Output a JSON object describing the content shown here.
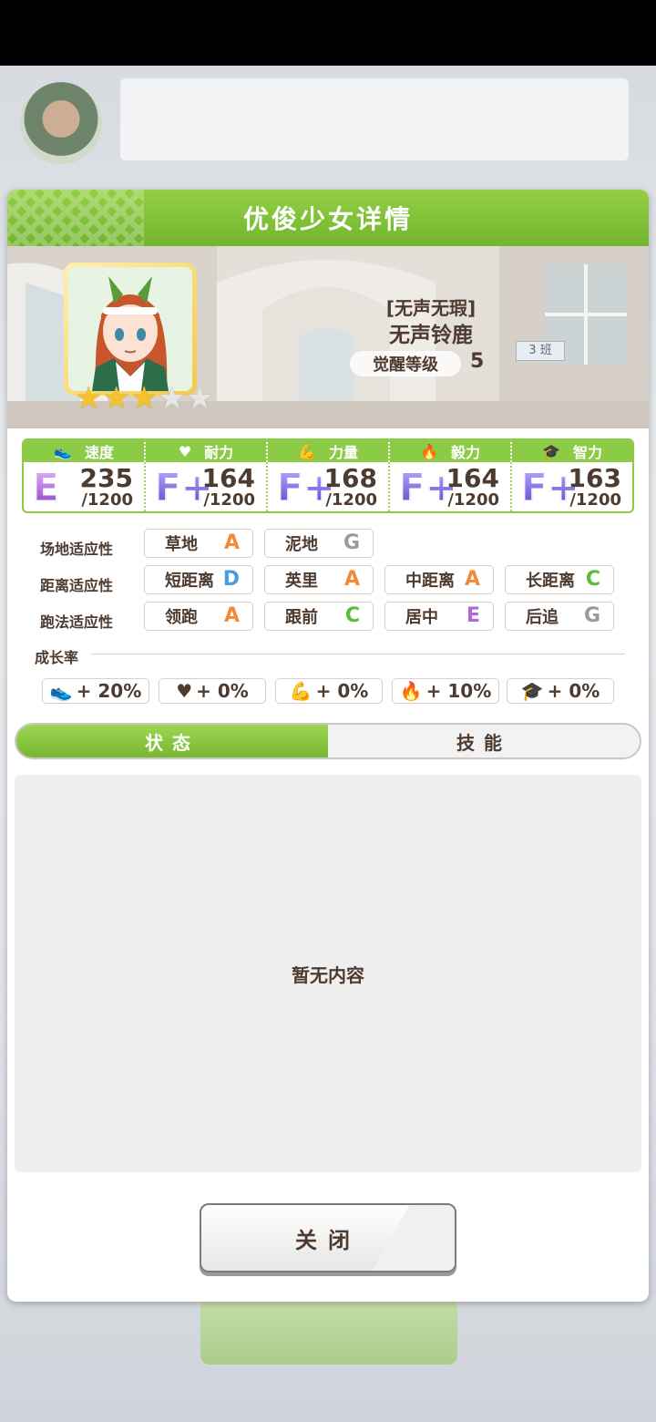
{
  "modal": {
    "title": "优俊少女详情",
    "epithet": "[无声无瑕]",
    "name": "无声铃鹿",
    "awaken_label": "觉醒等级",
    "awaken_value": "5",
    "class_sign": "3 班",
    "stars_filled": 3,
    "stars_total": 5
  },
  "stats": [
    {
      "name": "速度",
      "icon": "shoe-icon",
      "grade": "E",
      "value": "235",
      "max": "/1200"
    },
    {
      "name": "耐力",
      "icon": "heart-icon",
      "grade": "F+",
      "value": "164",
      "max": "/1200"
    },
    {
      "name": "力量",
      "icon": "muscle-icon",
      "grade": "F+",
      "value": "168",
      "max": "/1200"
    },
    {
      "name": "毅力",
      "icon": "flame-icon",
      "grade": "F+",
      "value": "164",
      "max": "/1200"
    },
    {
      "name": "智力",
      "icon": "graduation-cap-icon",
      "grade": "F+",
      "value": "163",
      "max": "/1200"
    }
  ],
  "aptitude": {
    "track_label": "场地适应性",
    "track": [
      {
        "name": "草地",
        "grade": "A"
      },
      {
        "name": "泥地",
        "grade": "G"
      }
    ],
    "distance_label": "距离适应性",
    "distance": [
      {
        "name": "短距离",
        "grade": "D"
      },
      {
        "name": "英里",
        "grade": "A"
      },
      {
        "name": "中距离",
        "grade": "A"
      },
      {
        "name": "长距离",
        "grade": "C"
      }
    ],
    "style_label": "跑法适应性",
    "style": [
      {
        "name": "领跑",
        "grade": "A"
      },
      {
        "name": "跟前",
        "grade": "C"
      },
      {
        "name": "居中",
        "grade": "E"
      },
      {
        "name": "后追",
        "grade": "G"
      }
    ]
  },
  "growth": {
    "label": "成长率",
    "items": [
      {
        "icon": "shoe-icon",
        "value": "+ 20%"
      },
      {
        "icon": "heart-icon",
        "value": "+ 0%"
      },
      {
        "icon": "muscle-icon",
        "value": "+ 0%"
      },
      {
        "icon": "flame-icon",
        "value": "+ 10%"
      },
      {
        "icon": "graduation-cap-icon",
        "value": "+ 0%"
      }
    ]
  },
  "tabs": [
    {
      "label": "状态",
      "active": true
    },
    {
      "label": "技能",
      "active": false
    }
  ],
  "content": {
    "empty_text": "暂无内容"
  },
  "close_label": "关闭",
  "colors": {
    "accent_green": "#8ccb45",
    "text_brown": "#4d3b2f",
    "grade_A": "#f08a3a",
    "grade_C": "#5dbb39",
    "grade_D": "#4a9be0",
    "grade_E": "#b068d8",
    "grade_G": "#9a9a9a"
  }
}
